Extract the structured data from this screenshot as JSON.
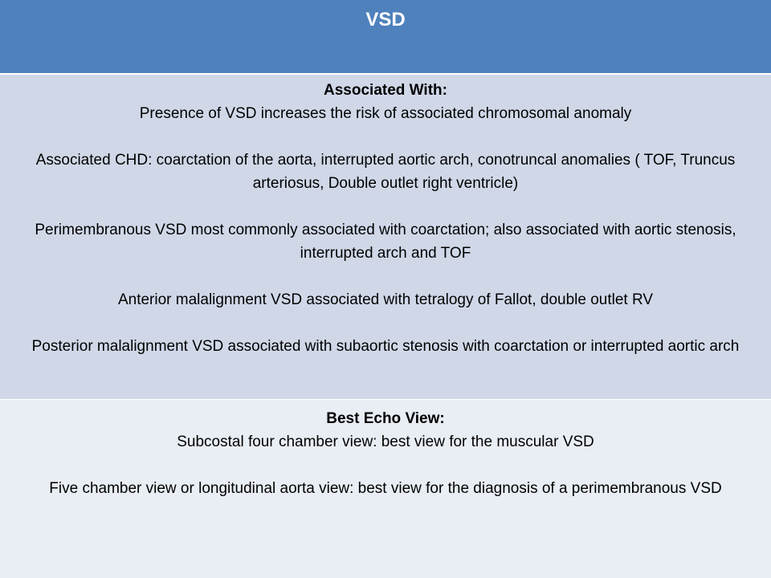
{
  "header": {
    "title": "VSD"
  },
  "associated": {
    "heading": "Associated With:",
    "paragraphs": [
      "Presence of VSD increases the risk of associated chromosomal anomaly",
      "Associated CHD: coarctation of the aorta, interrupted aortic arch, conotruncal anomalies ( TOF, Truncus arteriosus, Double outlet right ventricle)",
      "Perimembranous VSD most commonly associated with coarctation; also associated with aortic stenosis, interrupted arch and TOF",
      "Anterior malalignment VSD associated with tetralogy of Fallot, double outlet RV",
      "Posterior malalignment VSD associated with subaortic stenosis with coarctation or interrupted aortic arch"
    ]
  },
  "echo": {
    "heading": "Best Echo View:",
    "paragraphs": [
      "Subcostal four chamber view: best view for the muscular VSD",
      "Five chamber view or longitudinal aorta view: best view for the diagnosis of a perimembranous VSD"
    ]
  },
  "colors": {
    "header_bg": "#4f81bd",
    "row_one_bg": "#d0d8e8",
    "row_two_bg": "#e9edf4"
  }
}
